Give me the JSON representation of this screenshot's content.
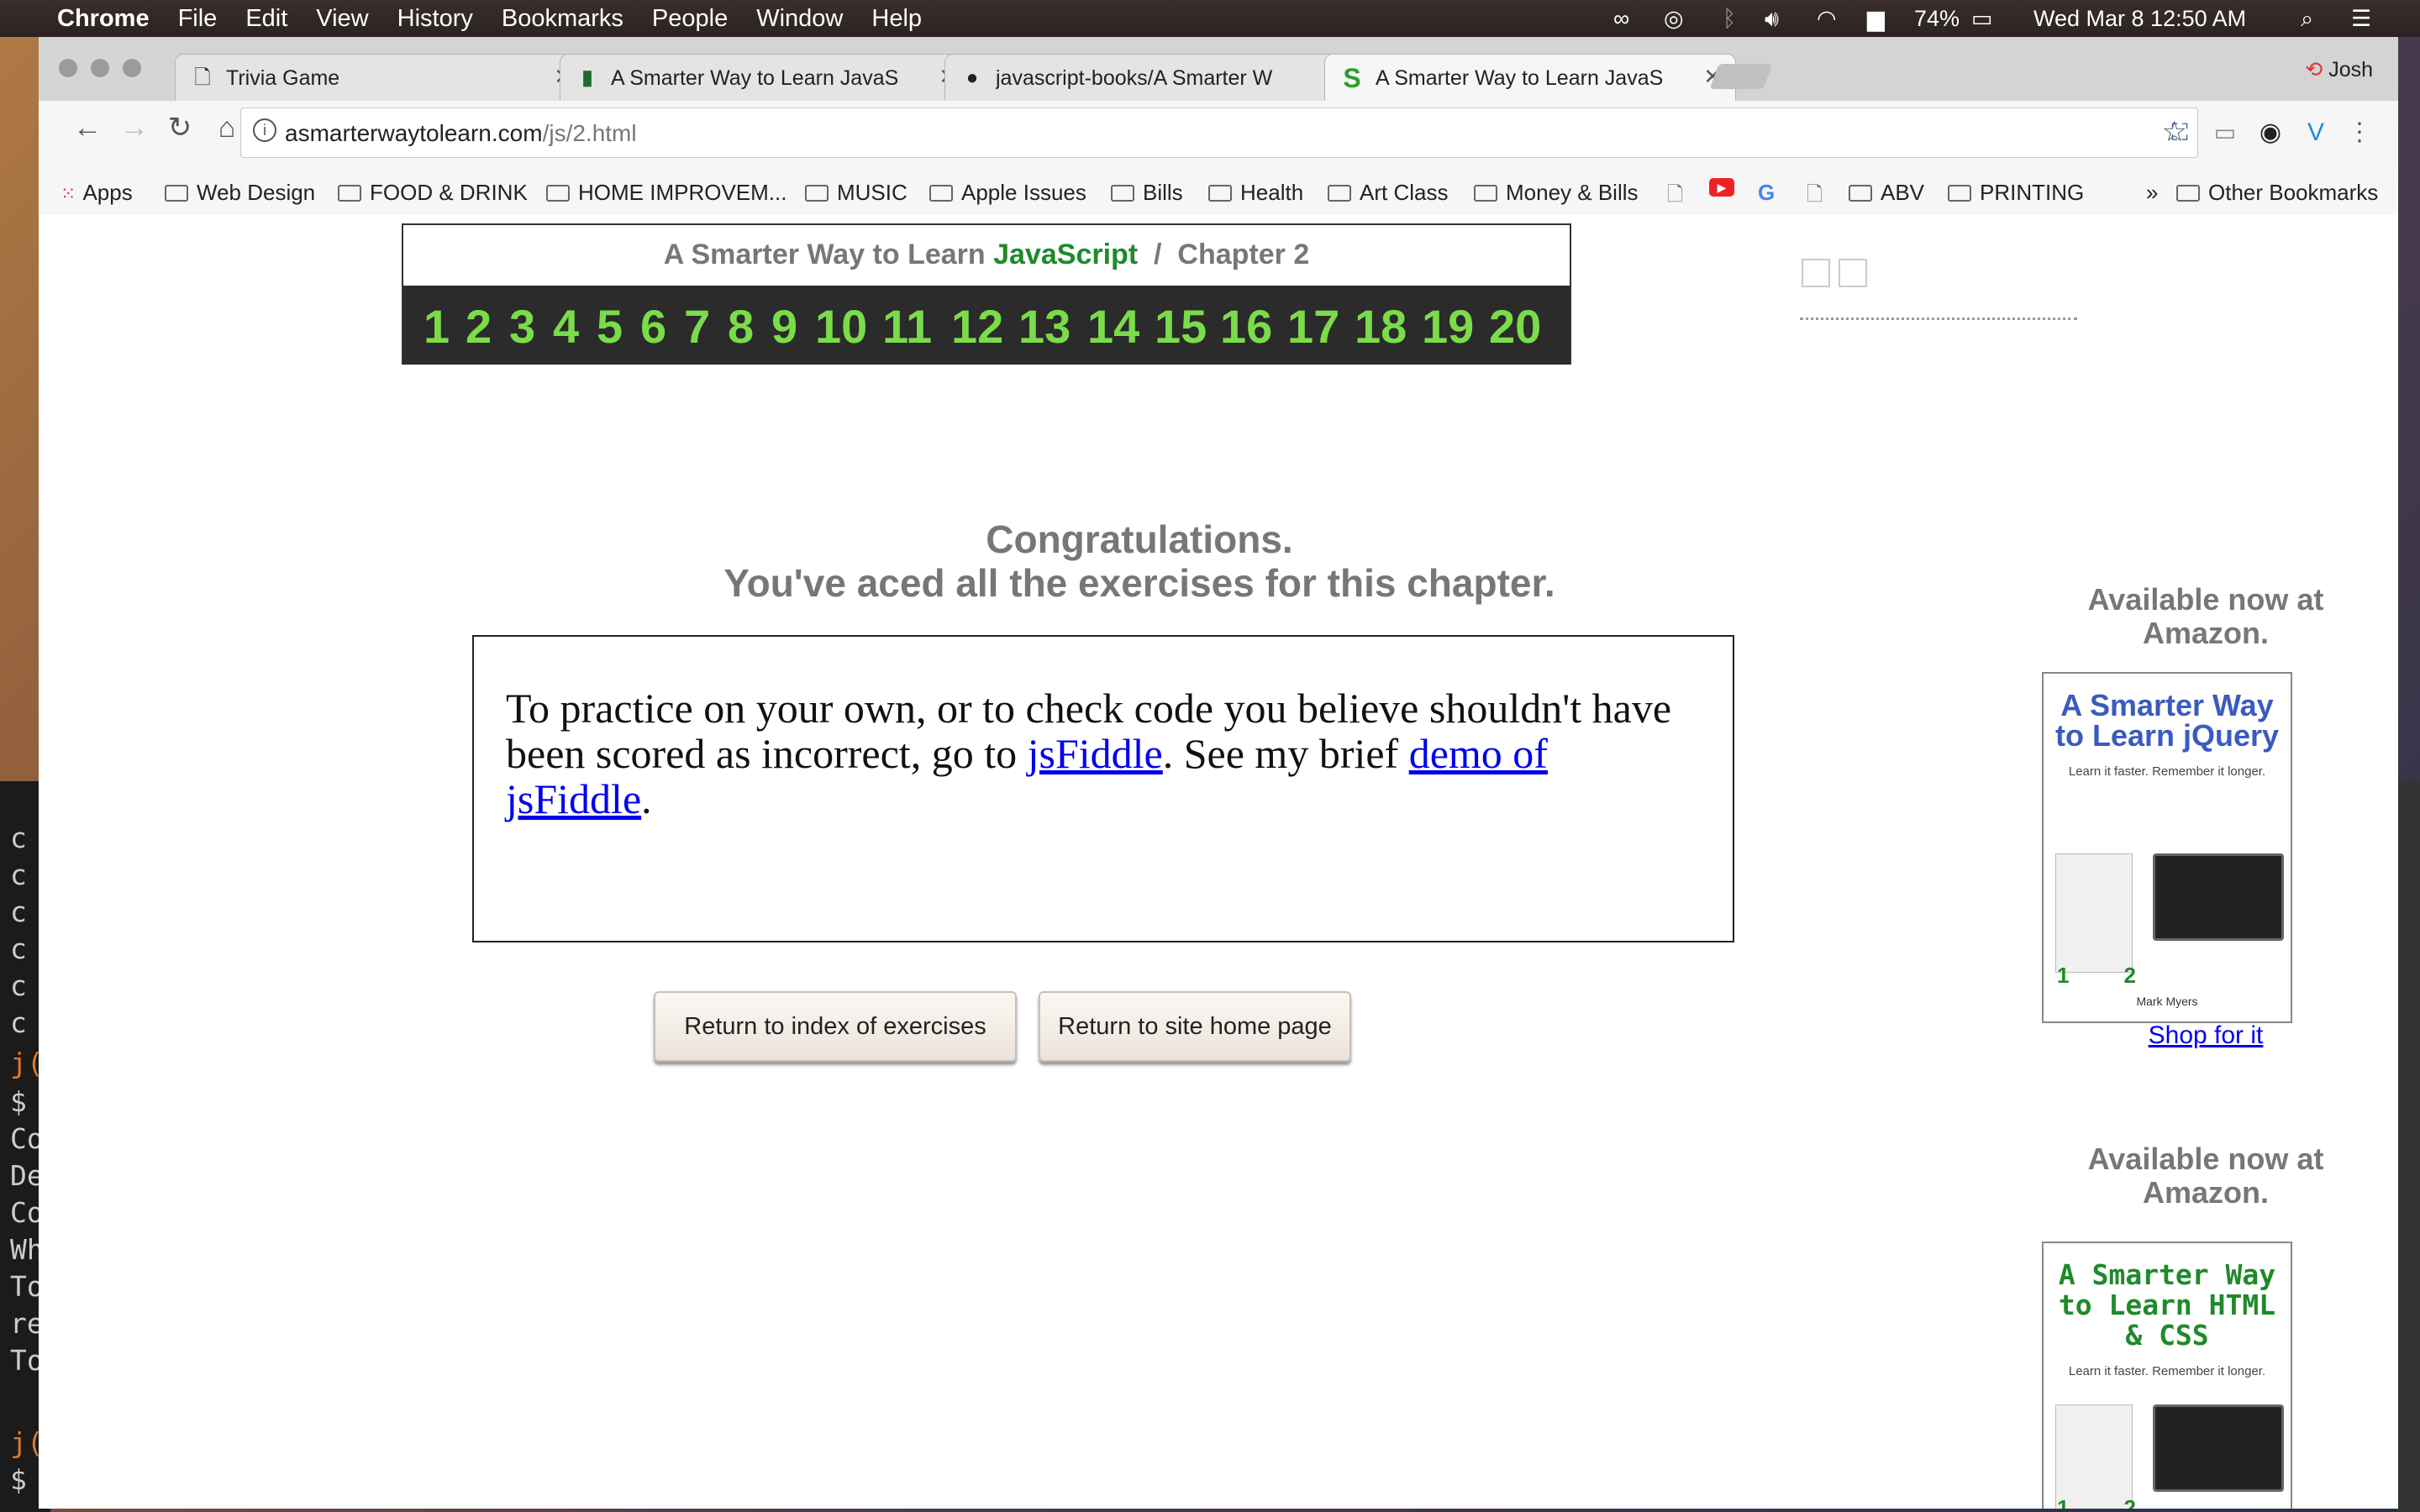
{
  "menubar": {
    "app": "Chrome",
    "items": [
      "File",
      "Edit",
      "View",
      "History",
      "Bookmarks",
      "People",
      "Window",
      "Help"
    ],
    "battery": "74%",
    "clock": "Wed Mar 8  12:50 AM"
  },
  "browser": {
    "tabs": [
      {
        "title": "Trivia Game",
        "icon": "document-icon"
      },
      {
        "title": "A Smarter Way to Learn JavaS",
        "icon": "book-icon"
      },
      {
        "title": "javascript-books/A Smarter W",
        "icon": "github-icon"
      },
      {
        "title": "A Smarter Way to Learn JavaS",
        "icon": "s-logo-icon"
      }
    ],
    "profile": "Josh",
    "url_host": "asmarterwaytolearn.com",
    "url_path": "/js/2.html",
    "bookmarks": [
      "Apps",
      "Web Design",
      "FOOD & DRINK",
      "HOME IMPROVEM...",
      "MUSIC",
      "Apple Issues",
      "Bills",
      "Health",
      "Art Class",
      "Money & Bills",
      "ABV",
      "PRINTING"
    ],
    "other_bookmarks": "Other Bookmarks",
    "overflow": "»"
  },
  "page": {
    "header_prefix": "A Smarter Way to Learn",
    "header_lang": "JavaScript",
    "header_sep": "/",
    "header_chapter": "Chapter 2",
    "chapters": [
      "1",
      "2",
      "3",
      "4",
      "5",
      "6",
      "7",
      "8",
      "9",
      "10",
      "11",
      "12",
      "13",
      "14",
      "15",
      "16",
      "17",
      "18",
      "19",
      "20"
    ],
    "congrats_line1": "Congratulations.",
    "congrats_line2": "You've aced all the exercises for this chapter.",
    "practice_text_1": "To practice on your own, or to check code you believe shouldn't have been scored as incorrect, go to",
    "practice_link_1": "jsFiddle",
    "practice_text_2": ". See my brief",
    "practice_link_2": "demo of jsFiddle",
    "practice_text_3": ".",
    "btn_index": "Return to index of exercises",
    "btn_home": "Return to site home page"
  },
  "sidebar": {
    "avail1": "Available now at Amazon.",
    "book1_title": "A Smarter Way to Learn jQuery",
    "book1_sub": "Learn it faster. Remember it longer.",
    "book1_author": "Mark Myers",
    "shop": "Shop for it",
    "avail2": "Available now at Amazon.",
    "book2_title": "A Smarter Way to Learn HTML & CSS",
    "book2_sub": "Learn it faster. Remember it longer."
  },
  "terminal": {
    "lines": [
      "c",
      "c",
      "c",
      "c",
      "c",
      "c",
      "j(",
      "$",
      "Co",
      "De",
      "Co",
      "Wh",
      "To",
      "re",
      "To",
      "j(",
      "$"
    ]
  },
  "colors": {
    "js_green": "#1f8a2b",
    "chapter_green": "#7bdc4a",
    "link_blue": "#0000ee"
  }
}
